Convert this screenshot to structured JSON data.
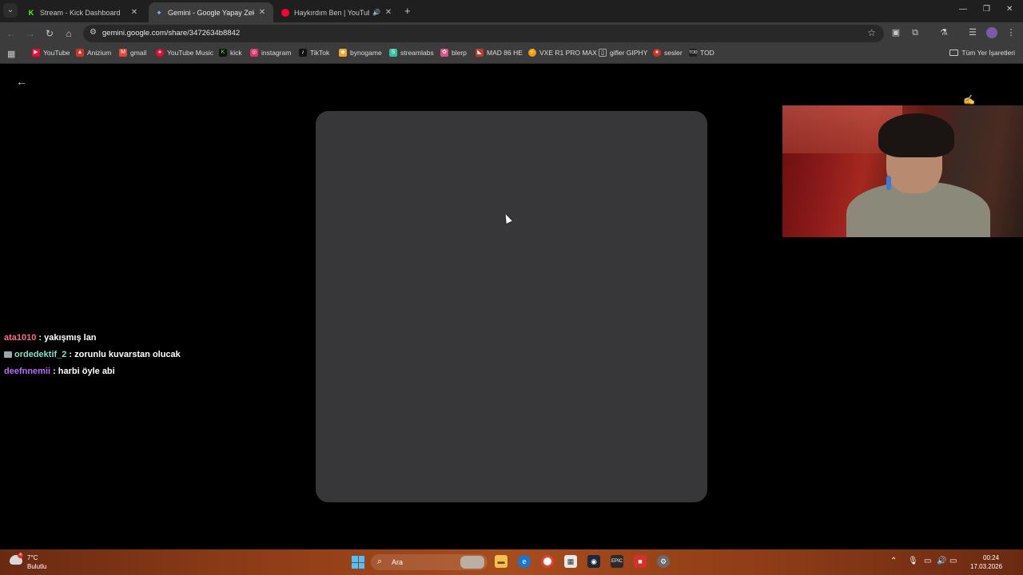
{
  "browser": {
    "tabs": [
      {
        "title": "Stream - Kick Dashboard",
        "favicon_color": "#53fc18",
        "active": false
      },
      {
        "title": "Gemini - Google Yapay Zeka'ya",
        "favicon_color": "#8ab4f8",
        "active": true
      },
      {
        "title": "Haykırdım Ben | YouTube M",
        "favicon_color": "#ff0033",
        "active": false
      }
    ],
    "url": "gemini.google.com/share/3472634b8842",
    "bookmarks": [
      {
        "label": "YouTube",
        "color": "#ff0033"
      },
      {
        "label": "Anizium",
        "color": "#d93025"
      },
      {
        "label": "gmail",
        "color": "#ea4335"
      },
      {
        "label": "YouTube Music",
        "color": "#ff0033"
      },
      {
        "label": "kick",
        "color": "#53fc18"
      },
      {
        "label": "instagram",
        "color": "#e1306c"
      },
      {
        "label": "TikTok",
        "color": "#111111"
      },
      {
        "label": "bynogame",
        "color": "#f5a623"
      },
      {
        "label": "streamlabs",
        "color": "#31c3a2"
      },
      {
        "label": "blerp",
        "color": "#e74c8b"
      },
      {
        "label": "MAD 86 HE",
        "color": "#c0392b"
      },
      {
        "label": "VXE R1 PRO MAX",
        "color": "#f39c12"
      },
      {
        "label": "gifler GIPHY",
        "color": "#333333"
      },
      {
        "label": "sesler",
        "color": "#d93025"
      },
      {
        "label": "TOD",
        "color": "#222222"
      }
    ],
    "all_bookmarks_label": "Tüm Yer İşaretleri"
  },
  "chat": [
    {
      "user": "ata1010",
      "user_color": "#ff6b8b",
      "message": ": yakışmış lan",
      "badge": false
    },
    {
      "user": "ordedektif_2",
      "user_color": "#7fe3c8",
      "message": ": zorunlu kuvarstan olucak",
      "badge": true
    },
    {
      "user": "deefnnemii",
      "user_color": "#b86cff",
      "message": ": harbi öyle abi",
      "badge": false
    }
  ],
  "taskbar": {
    "weather_temp": "7°C",
    "weather_desc": "Bulutlu",
    "weather_alert": "4",
    "search_placeholder": "Ara",
    "time": "00:24",
    "date": "17.03.2026"
  },
  "colors": {
    "accent": "#4cc2ff",
    "card_background": "#373739"
  }
}
